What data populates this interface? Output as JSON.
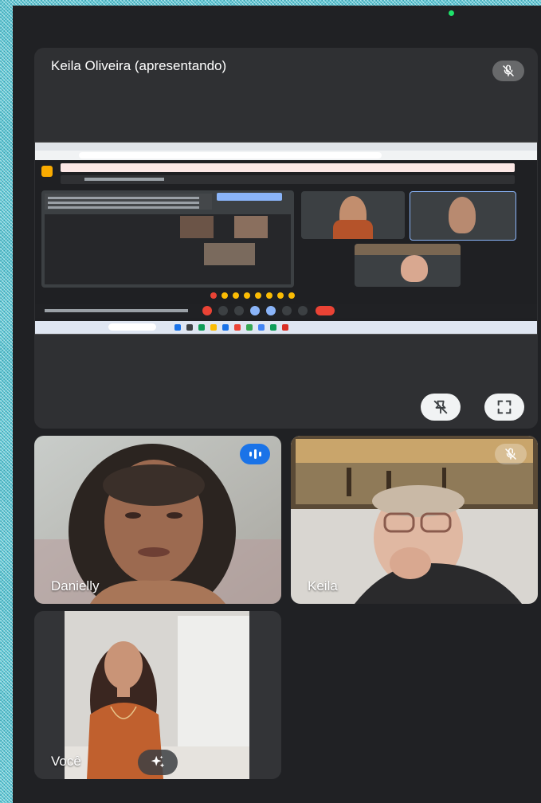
{
  "presenter_tile": {
    "title": "Keila Oliveira (apresentando)"
  },
  "participants": [
    {
      "name": "Danielly"
    },
    {
      "name": "Keila"
    },
    {
      "name": "Você"
    }
  ],
  "icons": {
    "presenter_mic": "mic-off-icon",
    "unpin": "pin-off-icon",
    "fullscreen": "fullscreen-icon",
    "danielly_audio": "speaking-icon",
    "keila_mic": "mic-off-icon",
    "effects": "sparkles-icon"
  },
  "colors": {
    "background": "#202124",
    "tile": "#3c4043",
    "speaking": "#1a73e8",
    "status_dot": "#1ee36b"
  }
}
